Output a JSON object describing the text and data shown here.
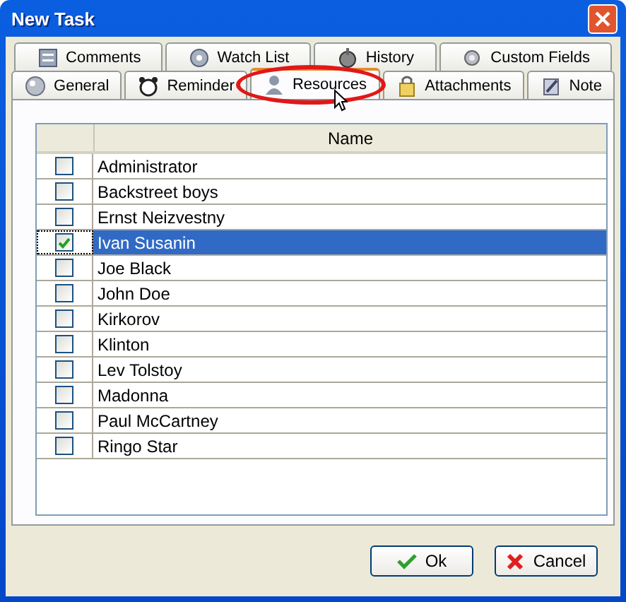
{
  "window": {
    "title": "New Task"
  },
  "tab_rows": [
    [
      {
        "label": "Comments",
        "selected": false
      },
      {
        "label": "Watch List",
        "selected": false
      },
      {
        "label": "History",
        "selected": false
      },
      {
        "label": "Custom Fields",
        "selected": false
      }
    ],
    [
      {
        "label": "General",
        "selected": false
      },
      {
        "label": "Reminder",
        "selected": false
      },
      {
        "label": "Resources",
        "selected": true
      },
      {
        "label": "Attachments",
        "selected": false
      },
      {
        "label": "Note",
        "selected": false
      }
    ]
  ],
  "table": {
    "columns": [
      {
        "label": "Name"
      }
    ],
    "rows": [
      {
        "name": "Administrator",
        "checked": false,
        "selected": false
      },
      {
        "name": "Backstreet boys",
        "checked": false,
        "selected": false
      },
      {
        "name": "Ernst Neizvestny",
        "checked": false,
        "selected": false
      },
      {
        "name": "Ivan Susanin",
        "checked": true,
        "selected": true
      },
      {
        "name": "Joe Black",
        "checked": false,
        "selected": false
      },
      {
        "name": "John Doe",
        "checked": false,
        "selected": false
      },
      {
        "name": "Kirkorov",
        "checked": false,
        "selected": false
      },
      {
        "name": "Klinton",
        "checked": false,
        "selected": false
      },
      {
        "name": "Lev Tolstoy",
        "checked": false,
        "selected": false
      },
      {
        "name": "Madonna",
        "checked": false,
        "selected": false
      },
      {
        "name": "Paul McCartney",
        "checked": false,
        "selected": false
      },
      {
        "name": "Ringo Star",
        "checked": false,
        "selected": false
      }
    ]
  },
  "buttons": [
    {
      "label": "Ok",
      "kind": "ok"
    },
    {
      "label": "Cancel",
      "kind": "cancel"
    }
  ]
}
